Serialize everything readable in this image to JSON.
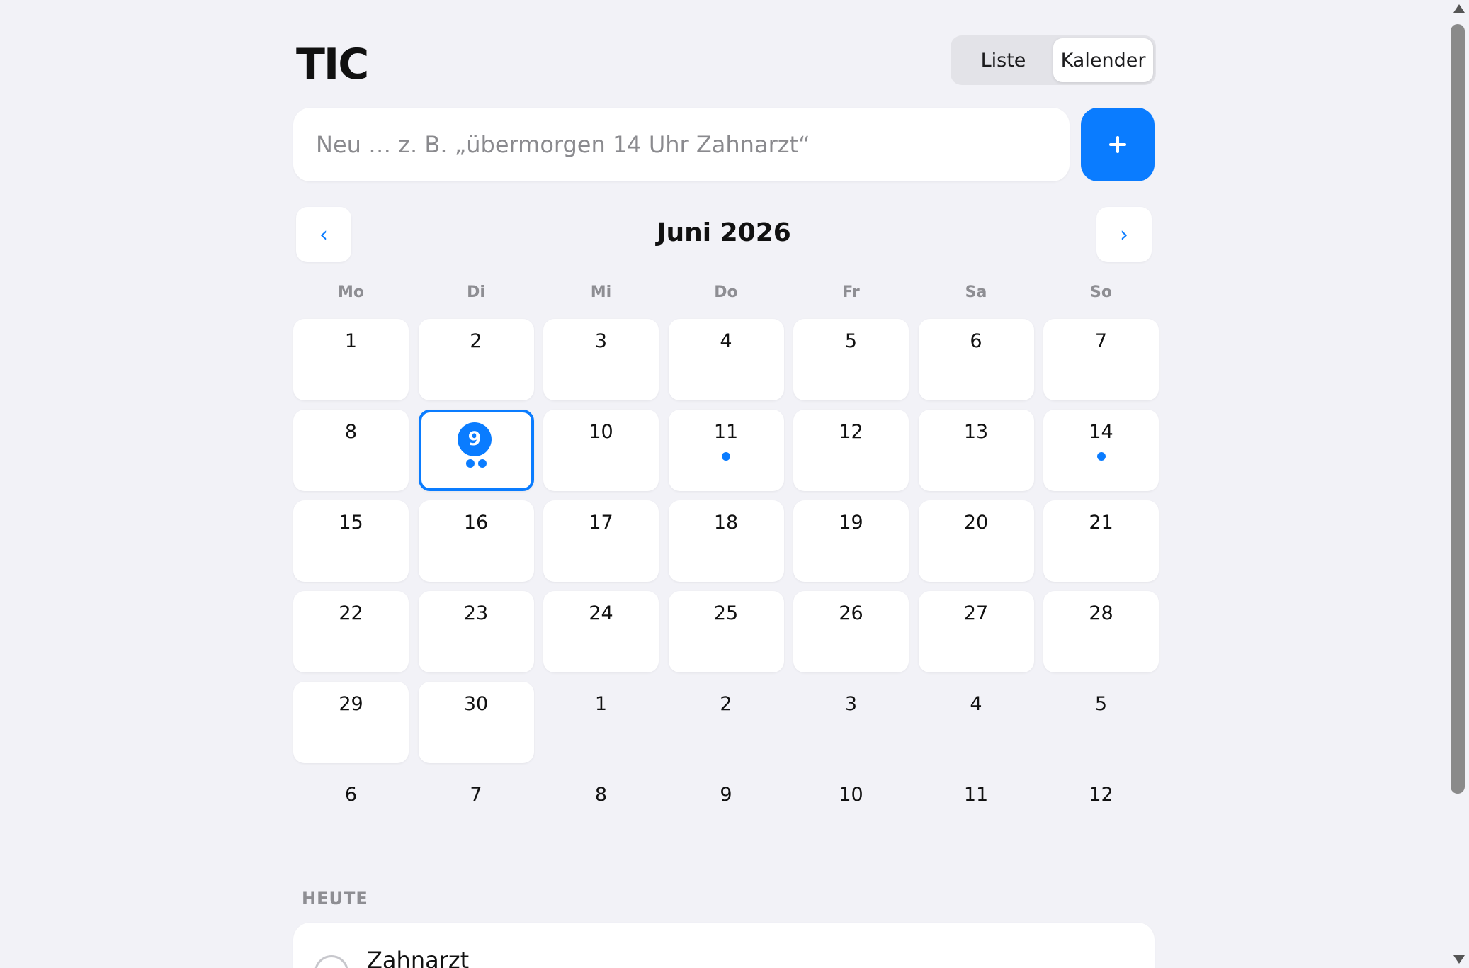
{
  "app": {
    "logo": "TIC"
  },
  "view_toggle": {
    "list_label": "Liste",
    "calendar_label": "Kalender",
    "active": "Kalender"
  },
  "composer": {
    "placeholder": "Neu … z. B. „übermorgen 14 Uhr Zahnarzt“",
    "value": "",
    "add_icon": "plus-icon"
  },
  "calendar": {
    "month_title": "Juni 2026",
    "prev_label": "‹",
    "next_label": "›",
    "weekdays": [
      "Mo",
      "Di",
      "Mi",
      "Do",
      "Fr",
      "Sa",
      "So"
    ],
    "days": [
      {
        "n": "1",
        "in": true,
        "dots": 0
      },
      {
        "n": "2",
        "in": true,
        "dots": 0
      },
      {
        "n": "3",
        "in": true,
        "dots": 0
      },
      {
        "n": "4",
        "in": true,
        "dots": 0
      },
      {
        "n": "5",
        "in": true,
        "dots": 0
      },
      {
        "n": "6",
        "in": true,
        "dots": 0
      },
      {
        "n": "7",
        "in": true,
        "dots": 0
      },
      {
        "n": "8",
        "in": true,
        "dots": 0
      },
      {
        "n": "9",
        "in": true,
        "dots": 2,
        "selected": true
      },
      {
        "n": "10",
        "in": true,
        "dots": 0
      },
      {
        "n": "11",
        "in": true,
        "dots": 1
      },
      {
        "n": "12",
        "in": true,
        "dots": 0
      },
      {
        "n": "13",
        "in": true,
        "dots": 0
      },
      {
        "n": "14",
        "in": true,
        "dots": 1
      },
      {
        "n": "15",
        "in": true,
        "dots": 0
      },
      {
        "n": "16",
        "in": true,
        "dots": 0
      },
      {
        "n": "17",
        "in": true,
        "dots": 0
      },
      {
        "n": "18",
        "in": true,
        "dots": 0
      },
      {
        "n": "19",
        "in": true,
        "dots": 0
      },
      {
        "n": "20",
        "in": true,
        "dots": 0
      },
      {
        "n": "21",
        "in": true,
        "dots": 0
      },
      {
        "n": "22",
        "in": true,
        "dots": 0
      },
      {
        "n": "23",
        "in": true,
        "dots": 0
      },
      {
        "n": "24",
        "in": true,
        "dots": 0
      },
      {
        "n": "25",
        "in": true,
        "dots": 0
      },
      {
        "n": "26",
        "in": true,
        "dots": 0
      },
      {
        "n": "27",
        "in": true,
        "dots": 0
      },
      {
        "n": "28",
        "in": true,
        "dots": 0
      },
      {
        "n": "29",
        "in": true,
        "dots": 0
      },
      {
        "n": "30",
        "in": true,
        "dots": 0
      },
      {
        "n": "1",
        "in": false,
        "dots": 0
      },
      {
        "n": "2",
        "in": false,
        "dots": 0
      },
      {
        "n": "3",
        "in": false,
        "dots": 0
      },
      {
        "n": "4",
        "in": false,
        "dots": 0
      },
      {
        "n": "5",
        "in": false,
        "dots": 0
      },
      {
        "n": "6",
        "in": false,
        "dots": 0
      },
      {
        "n": "7",
        "in": false,
        "dots": 0
      },
      {
        "n": "8",
        "in": false,
        "dots": 0
      },
      {
        "n": "9",
        "in": false,
        "dots": 0
      },
      {
        "n": "10",
        "in": false,
        "dots": 0
      },
      {
        "n": "11",
        "in": false,
        "dots": 0
      },
      {
        "n": "12",
        "in": false,
        "dots": 0
      }
    ]
  },
  "today": {
    "label": "HEUTE",
    "events": [
      {
        "title": "Zahnarzt",
        "done": false
      }
    ]
  },
  "colors": {
    "accent": "#0a7cff",
    "background": "#f2f2f7",
    "card": "#ffffff",
    "muted": "#8e8e93"
  }
}
